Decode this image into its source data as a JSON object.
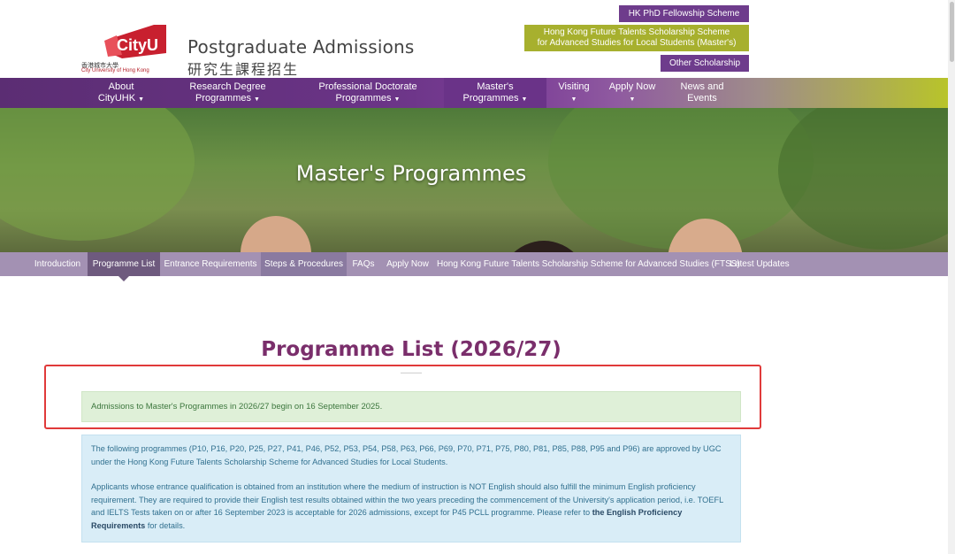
{
  "header": {
    "logo_word": "CityU",
    "logo_text_zh": "香港城市大學",
    "logo_text_en": "City University of Hong Kong",
    "title": "Postgraduate Admissions",
    "title_zh": "研究生課程招生",
    "top_links": {
      "phd": "HK PhD Fellowship Scheme",
      "ftss_line1": "Hong Kong Future Talents Scholarship Scheme",
      "ftss_line2": "for Advanced Studies for Local Students (Master's)",
      "other": "Other Scholarship"
    }
  },
  "mainnav": {
    "about_l1": "About",
    "about_l2": "CityUHK",
    "research_l1": "Research Degree",
    "research_l2": "Programmes",
    "professional_l1": "Professional Doctorate",
    "professional_l2": "Programmes",
    "masters_l1": "Master's",
    "masters_l2": "Programmes",
    "visiting_l1": "Visiting",
    "apply_l1": "Apply Now",
    "news_l1": "News and",
    "news_l2": "Events"
  },
  "hero": {
    "title": "Master's Programmes"
  },
  "subnav": {
    "items": [
      "Introduction",
      "Programme List",
      "Entrance Requirements",
      "Steps & Procedures",
      "FAQs",
      "Apply Now",
      "Hong Kong Future Talents Scholarship Scheme for Advanced Studies (FTSS)",
      "Latest Updates"
    ]
  },
  "content": {
    "heading": "Programme List (2026/27)",
    "notice": "Admissions to Master's Programmes in 2026/27 begin on 16 September 2025.",
    "info_p1": "The following programmes (P10, P16, P20, P25, P27, P41, P46, P52, P53, P54, P58, P63, P66, P69, P70, P71, P75, P80, P81, P85, P88, P95 and P96) are approved by UGC under the Hong Kong Future Talents Scholarship Scheme for Advanced Studies for Local Students.",
    "info_p2_pre": "Applicants whose entrance qualification is obtained from an institution where the medium of instruction is NOT English should also fulfill the minimum English proficiency requirement. They are required to provide their English test results obtained within the two years preceding the commencement of the University's application period, i.e. TOEFL and IELTS Tests taken on or after 16 September 2023 is acceptable for 2026 admissions, except for P45 PCLL programme. Please refer to ",
    "info_p2_link": "the English Proficiency Requirements",
    "info_p2_post": " for details."
  },
  "colors": {
    "brand_purple": "#6e3c8c",
    "brand_green": "#a7b02e",
    "heading_purple": "#7a2e6b",
    "highlight_red": "#e03a3a"
  }
}
